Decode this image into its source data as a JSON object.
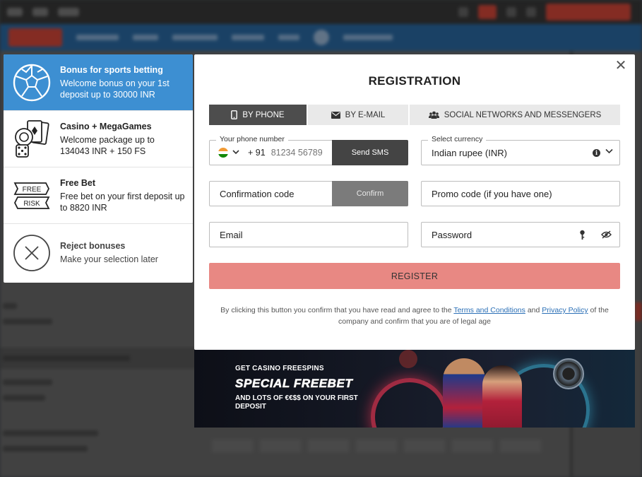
{
  "colors": {
    "accent_blue": "#3d8fd2",
    "register_button": "#e88883",
    "active_tab": "#4d4d4d",
    "link": "#2a6fb6"
  },
  "bonuses": [
    {
      "icon": "soccer-ball-icon",
      "title": "Bonus for sports betting",
      "desc": "Welcome bonus on your 1st deposit up to 30000 INR",
      "active": true
    },
    {
      "icon": "casino-chips-icon",
      "title": "Casino + MegaGames",
      "desc": "Welcome package up to 134043 INR + 150 FS",
      "active": false
    },
    {
      "icon": "free-risk-icon",
      "title": "Free Bet",
      "desc": "Free bet on your first deposit up to 8820 INR",
      "active": false,
      "icon_text": [
        "FREE",
        "RISK"
      ]
    },
    {
      "icon": "reject-x-icon",
      "title": "Reject bonuses",
      "desc": "Make your selection later",
      "active": false
    }
  ],
  "modal": {
    "title": "REGISTRATION",
    "close_icon": "close-icon",
    "tabs": [
      {
        "label": "BY PHONE",
        "icon": "phone-icon",
        "active": true
      },
      {
        "label": "BY E-MAIL",
        "icon": "envelope-icon",
        "active": false
      },
      {
        "label": "SOCIAL NETWORKS AND MESSENGERS",
        "icon": "people-icon",
        "active": false
      }
    ],
    "phone": {
      "legend": "Your phone number",
      "country_code": "+ 91",
      "placeholder": "81234 56789",
      "send_sms": "Send SMS"
    },
    "currency": {
      "legend": "Select currency",
      "value": "Indian rupee (INR)"
    },
    "confirmation": {
      "placeholder": "Confirmation code",
      "button": "Confirm"
    },
    "promo": {
      "placeholder": "Promo code (if you have one)"
    },
    "email": {
      "placeholder": "Email"
    },
    "password": {
      "placeholder": "Password"
    },
    "register_button": "REGISTER",
    "legal": {
      "pre": "By clicking this button you confirm that you have read and agree to the ",
      "terms": "Terms and Conditions",
      "and": " and ",
      "privacy": "Privacy Policy",
      "post": " of the company and confirm that you are of legal age"
    }
  },
  "banner": {
    "line1": "GET CASINO FREESPINS",
    "line2": "SPECIAL FREEBET",
    "line3": "AND LOTS OF €€$$ ON YOUR FIRST DEPOSIT"
  }
}
